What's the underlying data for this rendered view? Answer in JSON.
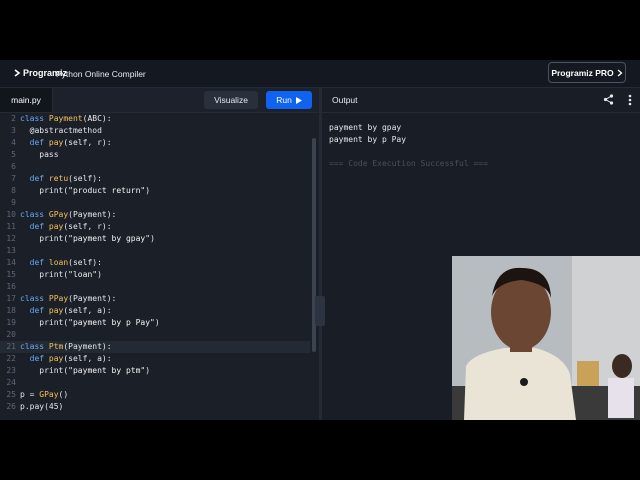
{
  "header": {
    "brand": "Programiz",
    "title": "Python Online Compiler",
    "pro_label": "Programiz PRO"
  },
  "editor": {
    "tab": "main.py",
    "visualize_label": "Visualize",
    "run_label": "Run",
    "lines": [
      {
        "n": "2",
        "tokens": [
          [
            "kw",
            "class "
          ],
          [
            "fn",
            "Payment"
          ],
          [
            "plain",
            "(ABC):"
          ]
        ]
      },
      {
        "n": "3",
        "tokens": [
          [
            "deco",
            "  @abstractmethod"
          ]
        ]
      },
      {
        "n": "4",
        "tokens": [
          [
            "kw",
            "  def "
          ],
          [
            "fn",
            "pay"
          ],
          [
            "plain",
            "(self, r):"
          ]
        ]
      },
      {
        "n": "5",
        "tokens": [
          [
            "plain",
            "    pass"
          ]
        ]
      },
      {
        "n": "6",
        "tokens": []
      },
      {
        "n": "7",
        "tokens": [
          [
            "kw",
            "  def "
          ],
          [
            "fn",
            "retu"
          ],
          [
            "plain",
            "(self):"
          ]
        ]
      },
      {
        "n": "8",
        "tokens": [
          [
            "plain",
            "    print("
          ],
          [
            "str",
            "\"product return\""
          ],
          [
            "plain",
            ")"
          ]
        ]
      },
      {
        "n": "9",
        "tokens": []
      },
      {
        "n": "10",
        "tokens": [
          [
            "kw",
            "class "
          ],
          [
            "fn",
            "GPay"
          ],
          [
            "plain",
            "(Payment):"
          ]
        ]
      },
      {
        "n": "11",
        "tokens": [
          [
            "kw",
            "  def "
          ],
          [
            "fn",
            "pay"
          ],
          [
            "plain",
            "(self, r):"
          ]
        ]
      },
      {
        "n": "12",
        "tokens": [
          [
            "plain",
            "    print("
          ],
          [
            "str",
            "\"payment by gpay\""
          ],
          [
            "plain",
            ")"
          ]
        ]
      },
      {
        "n": "13",
        "tokens": []
      },
      {
        "n": "14",
        "tokens": [
          [
            "kw",
            "  def "
          ],
          [
            "fn",
            "loan"
          ],
          [
            "plain",
            "(self):"
          ]
        ]
      },
      {
        "n": "15",
        "tokens": [
          [
            "plain",
            "    print("
          ],
          [
            "str",
            "\"loan\""
          ],
          [
            "plain",
            ")"
          ]
        ]
      },
      {
        "n": "16",
        "tokens": []
      },
      {
        "n": "17",
        "tokens": [
          [
            "kw",
            "class "
          ],
          [
            "fn",
            "PPay"
          ],
          [
            "plain",
            "(Payment):"
          ]
        ]
      },
      {
        "n": "18",
        "tokens": [
          [
            "kw",
            "  def "
          ],
          [
            "fn",
            "pay"
          ],
          [
            "plain",
            "(self, a):"
          ]
        ]
      },
      {
        "n": "19",
        "tokens": [
          [
            "plain",
            "    print("
          ],
          [
            "str",
            "\"payment by p Pay\""
          ],
          [
            "plain",
            ")"
          ]
        ]
      },
      {
        "n": "20",
        "tokens": []
      },
      {
        "n": "21",
        "tokens": [
          [
            "kw",
            "class "
          ],
          [
            "fn",
            "Ptm"
          ],
          [
            "plain",
            "(Payment):"
          ]
        ]
      },
      {
        "n": "22",
        "tokens": [
          [
            "kw",
            "  def "
          ],
          [
            "fn",
            "pay"
          ],
          [
            "plain",
            "(self, a):"
          ]
        ]
      },
      {
        "n": "23",
        "tokens": [
          [
            "plain",
            "    print("
          ],
          [
            "str",
            "\"payment by ptm\""
          ],
          [
            "plain",
            ")"
          ]
        ]
      },
      {
        "n": "24",
        "tokens": []
      },
      {
        "n": "25",
        "tokens": [
          [
            "plain",
            "p = "
          ],
          [
            "fn",
            "GPay"
          ],
          [
            "plain",
            "()"
          ]
        ]
      },
      {
        "n": "26",
        "tokens": [
          [
            "plain",
            "p.pay(45)"
          ]
        ]
      }
    ],
    "highlighted_line": "21"
  },
  "output": {
    "label": "Output",
    "lines": [
      "payment by gpay",
      "payment by p Pay"
    ],
    "status": "=== Code Execution Successful ==="
  },
  "colors": {
    "run_button": "#0f63f0",
    "keyword": "#6fa8f5",
    "function": "#f6c25a",
    "background": "#181d26"
  }
}
